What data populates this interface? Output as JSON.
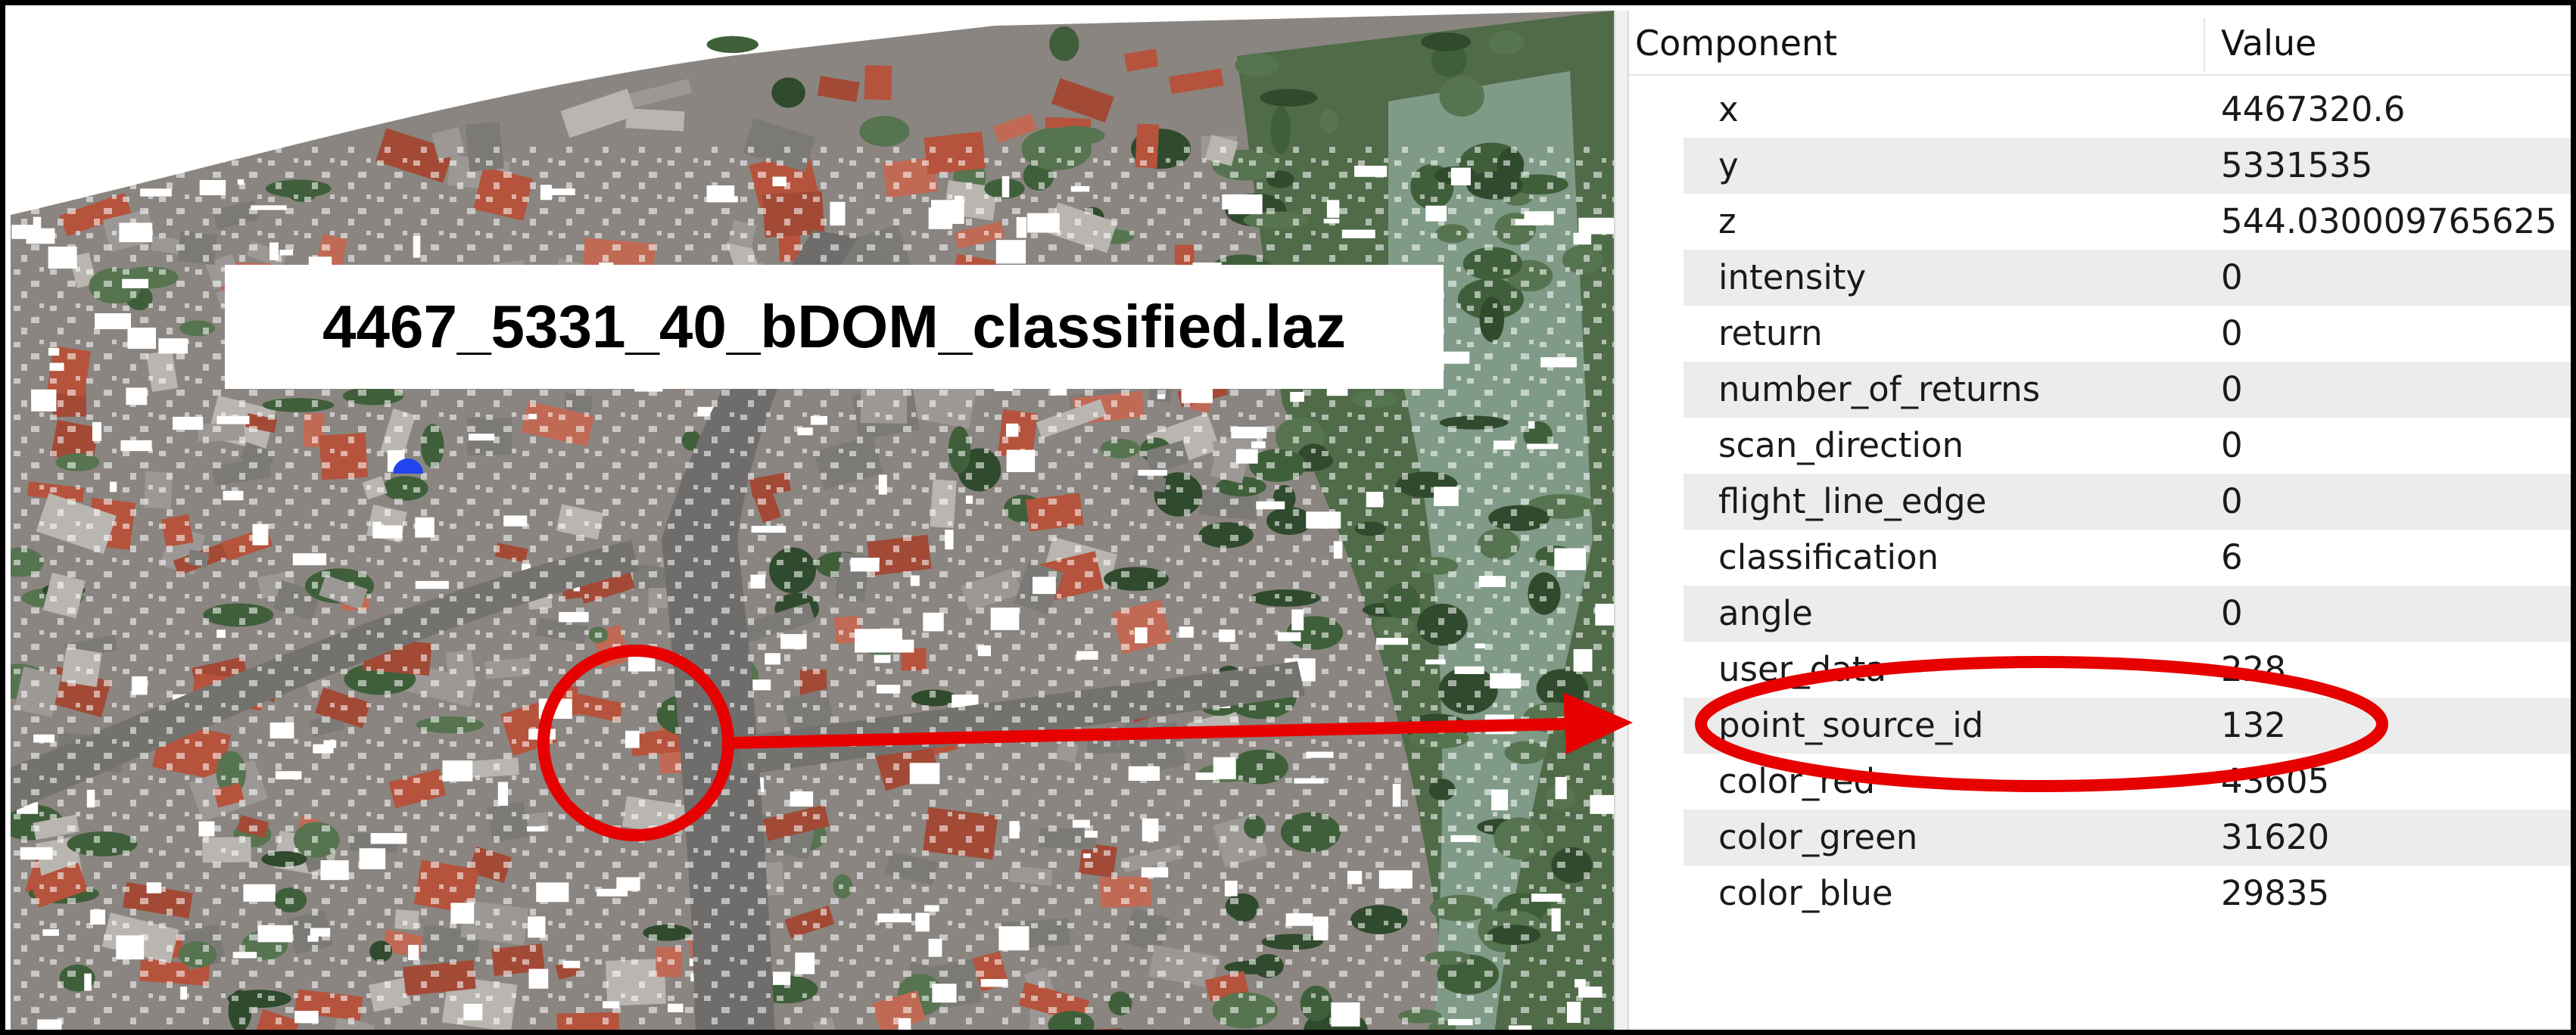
{
  "file_label": "4467_5331_40_bDOM_classified.laz",
  "table": {
    "headers": {
      "component": "Component",
      "value": "Value"
    },
    "rows": [
      {
        "name": "x",
        "value": "4467320.6"
      },
      {
        "name": "y",
        "value": "5331535"
      },
      {
        "name": "z",
        "value": "544.030009765625"
      },
      {
        "name": "intensity",
        "value": "0"
      },
      {
        "name": "return",
        "value": "0"
      },
      {
        "name": "number_of_returns",
        "value": "0"
      },
      {
        "name": "scan_direction",
        "value": "0"
      },
      {
        "name": "flight_line_edge",
        "value": "0"
      },
      {
        "name": "classification",
        "value": "6"
      },
      {
        "name": "angle",
        "value": "0"
      },
      {
        "name": "user_data",
        "value": "228"
      },
      {
        "name": "point_source_id",
        "value": "132"
      },
      {
        "name": "color_red",
        "value": "43605"
      },
      {
        "name": "color_green",
        "value": "31620"
      },
      {
        "name": "color_blue",
        "value": "29835"
      }
    ],
    "highlighted_row": "point_source_id"
  },
  "colors": {
    "annotation_red": "#e60000",
    "roof_red": "#b5533c",
    "tree_green": "#3f5f3a",
    "selected_point_blue": "#2244ee",
    "row_stripe": "#ececec"
  }
}
